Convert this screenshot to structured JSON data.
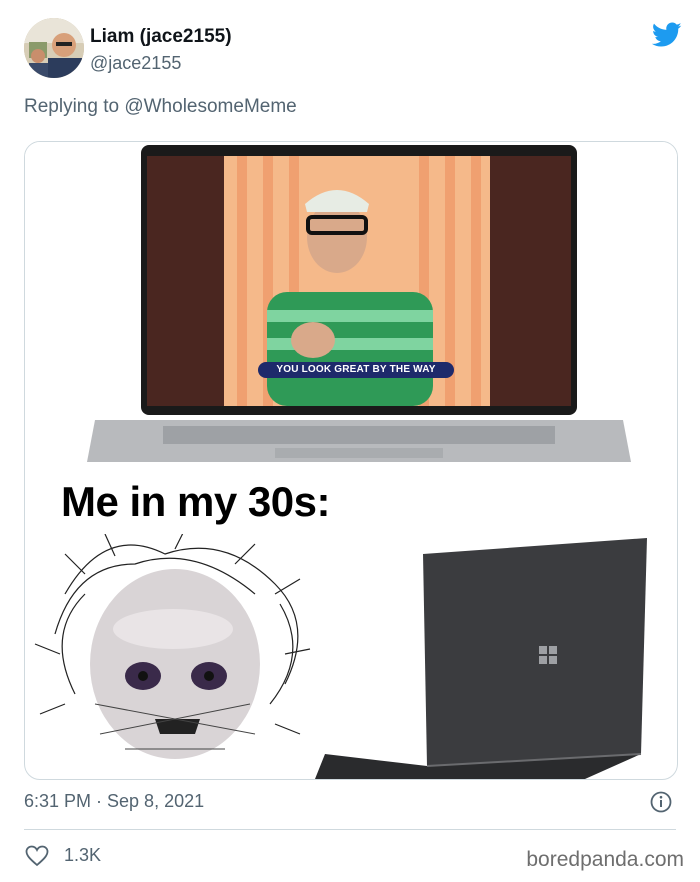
{
  "tweet": {
    "display_name": "Liam (jace2155)",
    "handle": "@jace2155",
    "replying_to": "Replying to @WholesomeMeme",
    "timestamp": "6:31 PM · Sep 8, 2021",
    "like_count": "1.3K"
  },
  "meme": {
    "video_caption": "YOU LOOK GREAT BY THE WAY",
    "text": "Me in my 30s:"
  },
  "watermark": "boredpanda.com",
  "colors": {
    "twitter_blue": "#1d9bf0",
    "secondary_text": "#536471",
    "border": "#cfd9de"
  },
  "icons": [
    "twitter-bird-icon",
    "info-icon",
    "heart-icon",
    "windows-logo-icon"
  ]
}
